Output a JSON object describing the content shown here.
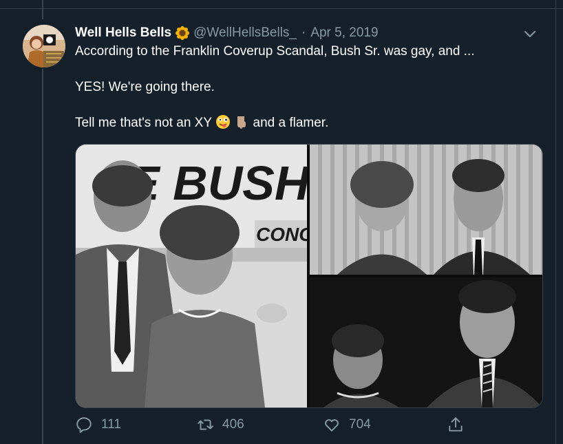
{
  "tweet": {
    "display_name": "Well Hells Bells",
    "handle": "@WellHellsBells_",
    "separator": "·",
    "date": "Apr 5, 2019",
    "lines": [
      "According to the Franklin Coverup Scandal, Bush Sr. was gay, and ...",
      "YES! We're going there.",
      "Tell me that's not an XY",
      "and a flamer."
    ]
  },
  "media": {
    "sign_text_1": "E BUSH",
    "sign_text_2": "CONG"
  },
  "actions": {
    "reply_count": "111",
    "retweet_count": "406",
    "like_count": "704"
  },
  "icons": {
    "name_badge": "sunflower-emoji",
    "menu": "chevron-down-icon",
    "reply": "reply-icon",
    "retweet": "retweet-icon",
    "like": "heart-icon",
    "share": "share-icon"
  },
  "colors": {
    "background": "#15202b",
    "secondary_text": "#8899a6",
    "border": "#38444d"
  }
}
